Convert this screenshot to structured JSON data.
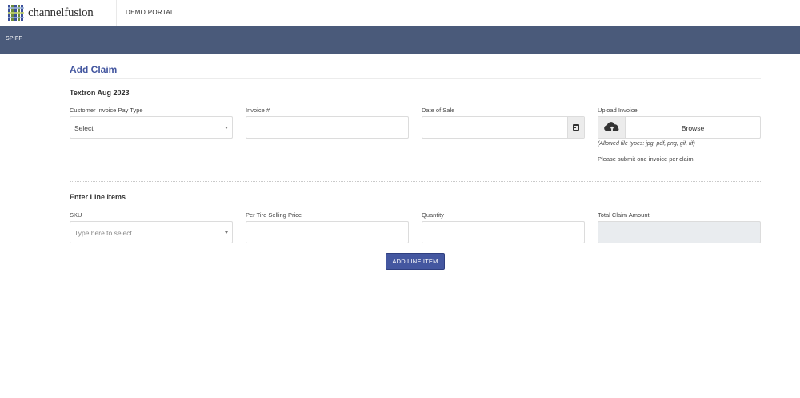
{
  "header": {
    "brand": "channelfusion",
    "portal_label": "DEMO PORTAL"
  },
  "nav": {
    "items": [
      {
        "label": "SPIFF"
      }
    ]
  },
  "page": {
    "title": "Add Claim",
    "program_title": "Textron Aug 2023"
  },
  "claim_form": {
    "pay_type": {
      "label": "Customer Invoice Pay Type",
      "value": "Select"
    },
    "invoice_number": {
      "label": "Invoice #",
      "value": ""
    },
    "date_of_sale": {
      "label": "Date of Sale",
      "value": ""
    },
    "upload": {
      "label": "Upload Invoice",
      "button": "Browse",
      "allowed": "(Allowed file types: jpg, pdf, png, gif, tif)",
      "note": "Please submit one invoice per claim."
    }
  },
  "line_items": {
    "title": "Enter Line Items",
    "sku": {
      "label": "SKU",
      "placeholder": "Type here to select"
    },
    "price": {
      "label": "Per Tire Selling Price",
      "value": ""
    },
    "quantity": {
      "label": "Quantity",
      "value": ""
    },
    "total": {
      "label": "Total Claim Amount",
      "value": ""
    },
    "add_button": "ADD LINE ITEM"
  },
  "colors": {
    "navbar": "#4a5a7a",
    "accent": "#4457a0"
  },
  "icons": [
    "calendar-icon",
    "cloud-upload-icon",
    "chevron-down-icon",
    "brand-logo-icon"
  ]
}
